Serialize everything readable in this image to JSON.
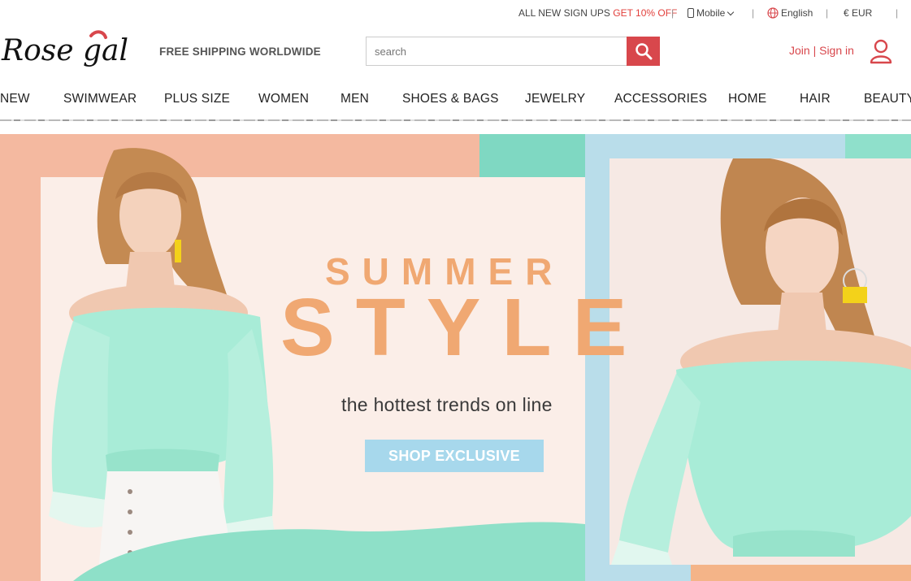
{
  "topbar": {
    "signup_text": "ALL NEW SIGN UPS ",
    "signup_offer": "GET 10% OFF",
    "mobile_label": "Mobile",
    "language_label": "English",
    "currency_label": "€ EUR",
    "separator": "|"
  },
  "header": {
    "logo_text": "Rose gal",
    "tagline": "FREE SHIPPING WORLDWIDE",
    "search_placeholder": "search",
    "join_label": "Join",
    "auth_separator": "|",
    "signin_label": "Sign in"
  },
  "nav": {
    "items": [
      "NEW",
      "SWIMWEAR",
      "PLUS SIZE",
      "WOMEN",
      "MEN",
      "SHOES & BAGS",
      "JEWELRY",
      "ACCESSORIES",
      "HOME",
      "HAIR",
      "BEAUTY"
    ]
  },
  "banner": {
    "headline_small": "SUMMER",
    "headline_large": "STYLE",
    "subheadline": "the hottest trends on line",
    "cta_label": "SHOP EXCLUSIVE"
  },
  "colors": {
    "brand_red": "#d8474c",
    "offer_red": "#e2403c",
    "banner_orange_text": "#f0a872",
    "cta_blue": "#a7d8ec",
    "banner_peach": "#f4b9a0",
    "banner_teal": "#7fd8c2"
  }
}
